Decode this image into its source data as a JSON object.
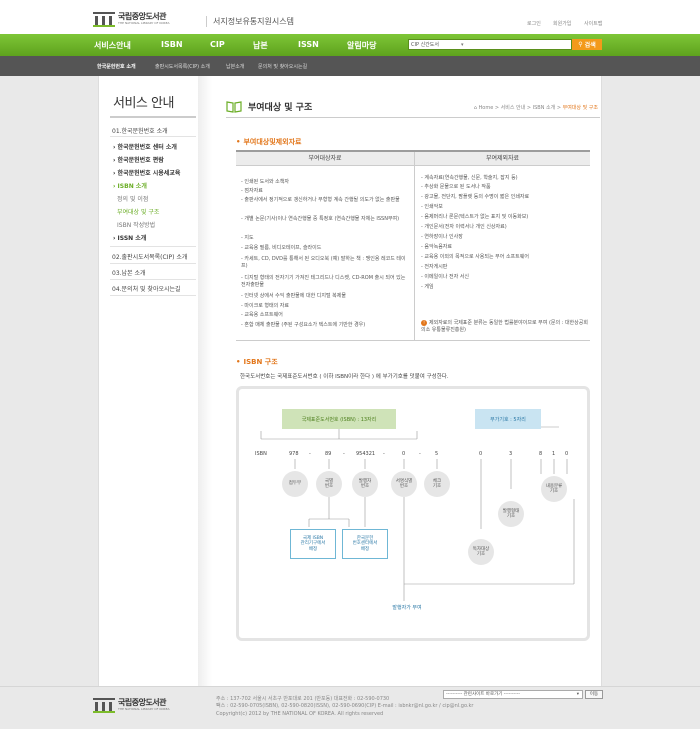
{
  "header": {
    "logo_kr": "국립중앙도서관",
    "logo_en": "THE NATIONAL LIBRARY OF KOREA",
    "site_title": "서지정보유통지원시스템",
    "util_links": [
      "로그인",
      "회원가입",
      "사이트맵"
    ]
  },
  "gnb": {
    "items": [
      "서비스안내",
      "ISBN",
      "CIP",
      "납본",
      "ISSN",
      "알림마당"
    ],
    "search_option": "CIP 신간도서",
    "search_button": "검색"
  },
  "subnav": {
    "items": [
      "한국문헌번호 소개",
      "출판시도서목록(CIP) 소개",
      "납본소개",
      "문의처 및 찾아오시는길"
    ]
  },
  "lnb": {
    "title": "서비스 안내",
    "items": [
      {
        "label": "01.한국문헌번호 소개"
      },
      {
        "label": "› 한국문헌번호 센터 소개"
      },
      {
        "label": "› 한국문헌번호 편람"
      },
      {
        "label": "› 한국문헌번호 시용세교육"
      },
      {
        "label": "› ISBN 소개"
      },
      {
        "label": "정의 및 이점"
      },
      {
        "label": "부여대상 및 구조"
      },
      {
        "label": "ISBN 작성방법"
      },
      {
        "label": "› ISSN 소개"
      },
      {
        "label": "02.출판시도서목록(CIP) 소개"
      },
      {
        "label": "03.납본 소개"
      },
      {
        "label": "04.문의처 및 찾아오시는길"
      }
    ]
  },
  "content": {
    "title": "부여대상 및 구조",
    "breadcrumb": [
      "Home",
      "서비스 안내",
      "ISBN 소개",
      "부여대상 및 구조"
    ],
    "section1_title": "부여대상및제외자료",
    "table_headers": [
      "부여대상자료",
      "부여제외자료"
    ],
    "left_rows": [
      "인쇄된 도서와 소책자",
      "점자자료",
      "출판사에서 정기적으로 갱신하거나 무형형 계속 간행될 의도가 없는 출판물",
      "개별 논문(기사)이나 연속간행물 중 특정호 (연속간행물 자체는 ISSN부여)",
      "지도",
      "교육용 필름, 비디오테이프, 슬라이드",
      "카세트, CD, DVD를 통해서 된 오디오북 (예) 말하는 책 : 맹인용 레코드 테이프)",
      "디지털 형태의 전자기기 가져진 테그리드나 디스켓, CD-ROM 출시 되어 있는 전자출판물",
      "인터넷 상에서 수익 출판물에 대한 디지털 복제물",
      "마이크로 형태의 자료",
      "교육용 소프트웨어",
      "혼합 매체 출판물 (주된 구성요소가 텍스트에 기반한 경우)"
    ],
    "right_rows": [
      "계속자료(연속간행물, 신문, 학술지, 잡지 등)",
      "추상화 문물으로 된 도서나 작품",
      "광고물, 전단지, 팜플렛 등의 수명이 짧은 인쇄자료",
      "인쇄악보",
      "음제머리나 론문(텍스트가 없는 표지 및 이동화보)",
      "개인문서(전자 이력서나 개인 신상자료)",
      "연하장이나 인사장",
      "음악녹음자료",
      "교육용 이외의 목적으로 사용되는 부어 소프트웨어",
      "전자게시판",
      "이메일이나 전자 서신",
      "게임"
    ],
    "notice": "제외자료의 국제표준 분류는 동일한 법률분야이므로 부여 (문의 : 대한상공회의소 유통물류진흥원)",
    "section2_title": "ISBN 구조",
    "isbn_desc": "한국도서번호는 국제표준도서번호 ( 이하 ISBN이라 한다 ) 에 부가기호를 덧붙여 구성한다.",
    "diagram": {
      "isbn_box": "국제표준도서번호 (ISBN) : 13자리",
      "add_box": "부가기호 : 5자리",
      "isbn_label": "ISBN",
      "numbers": [
        "978",
        "89",
        "954321",
        "0",
        "5"
      ],
      "add_numbers": [
        "0",
        "3",
        "8",
        "1",
        "0"
      ],
      "circles": [
        "접두부",
        "국별\n번호",
        "발행자\n번호",
        "서명식별\n번호",
        "체크\n기호"
      ],
      "add_circles": [
        "독자대상\n기호",
        "발행형태\n기호",
        "내용분류\n기호"
      ],
      "notes": [
        "국제 ISBN\n관리기구에서\n배정",
        "한국문헌\n번호센터에서\n배정"
      ],
      "publisher_note": "발행자가 부여"
    }
  },
  "footer": {
    "logo_kr": "국립중앙도서관",
    "logo_en": "THE NATIONAL LIBRARY OF KOREA",
    "address": "주소 : 137-702 서울시 서초구 반포대로 201 (반포동)  대표전화 : 02-590-0730",
    "contact": "팩스 : 02-590-0705(ISBN), 02-590-0820(ISSN), 02-590-0690(CIP)  E-mail : isbnkr@nl.go.kr / cip@nl.go.kr",
    "copyright": "Copyright(c) 2012 by THE NATIONAL OF KOREA. All rights reserved",
    "related_sites": "---------- 관련사이트 바로가기 ----------",
    "go_button": "이동"
  }
}
